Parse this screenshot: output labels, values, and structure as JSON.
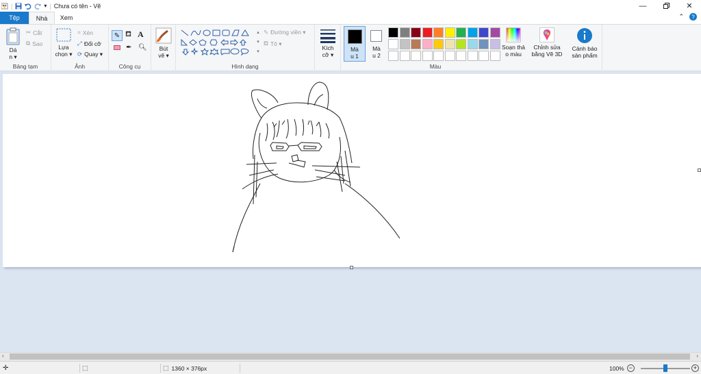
{
  "window": {
    "title": "Chưa có tên - Vẽ",
    "controls": [
      "minimize-icon",
      "restore-icon",
      "close-icon"
    ]
  },
  "tabs": [
    {
      "label": "Tệp",
      "active": false
    },
    {
      "label": "Nhà",
      "active": true
    },
    {
      "label": "Xem",
      "active": false
    }
  ],
  "ribbon": {
    "clipboard": {
      "label": "Bảng tạm",
      "paste": "Dá",
      "paste2": "n ▾",
      "cut": "Cắt",
      "copy": "Sao"
    },
    "image": {
      "label": "Ảnh",
      "select": "Lựa",
      "select2": "chọn ▾",
      "crop": "Xén",
      "resize": "Đổi cỡ",
      "rotate": "Quay ▾"
    },
    "tools": {
      "label": "Công cụ"
    },
    "brushes": {
      "label1": "Bút",
      "label2": "vẽ ▾"
    },
    "shapes": {
      "label": "Hình dạng",
      "outline": "Đường viền ▾",
      "fill": "Tô ▾"
    },
    "size": {
      "label1": "Kích",
      "label2": "cỡ ▾"
    },
    "color1": {
      "label1": "Mà",
      "label2": "u 1",
      "value": "#000000"
    },
    "color2": {
      "label1": "Mà",
      "label2": "u 2",
      "value": "#ffffff"
    },
    "colors": {
      "label": "Màu",
      "row1": [
        "#000000",
        "#7f7f7f",
        "#880015",
        "#ed1c24",
        "#ff7f27",
        "#fff200",
        "#22b14c",
        "#00a2e8",
        "#3f48cc",
        "#a349a4"
      ],
      "row2": [
        "#ffffff",
        "#c3c3c3",
        "#b97a57",
        "#ffaec9",
        "#ffc90e",
        "#efe4b0",
        "#b5e61d",
        "#99d9ea",
        "#7092be",
        "#c8bfe7"
      ],
      "row3": [
        "#ffffff",
        "#ffffff",
        "#ffffff",
        "#ffffff",
        "#ffffff",
        "#ffffff",
        "#ffffff",
        "#ffffff",
        "#ffffff",
        "#ffffff"
      ]
    },
    "editcolors": {
      "label1": "Soạn thả",
      "label2": "o màu"
    },
    "paint3d": {
      "label1": "Chỉnh sửa",
      "label2": "bằng Vẽ 3D"
    },
    "product": {
      "label1": "Cảnh báo",
      "label2": "sản phẩm"
    }
  },
  "status": {
    "dimensions": "1360 × 376px",
    "zoom": "100%",
    "zoom_level": 0.5
  }
}
